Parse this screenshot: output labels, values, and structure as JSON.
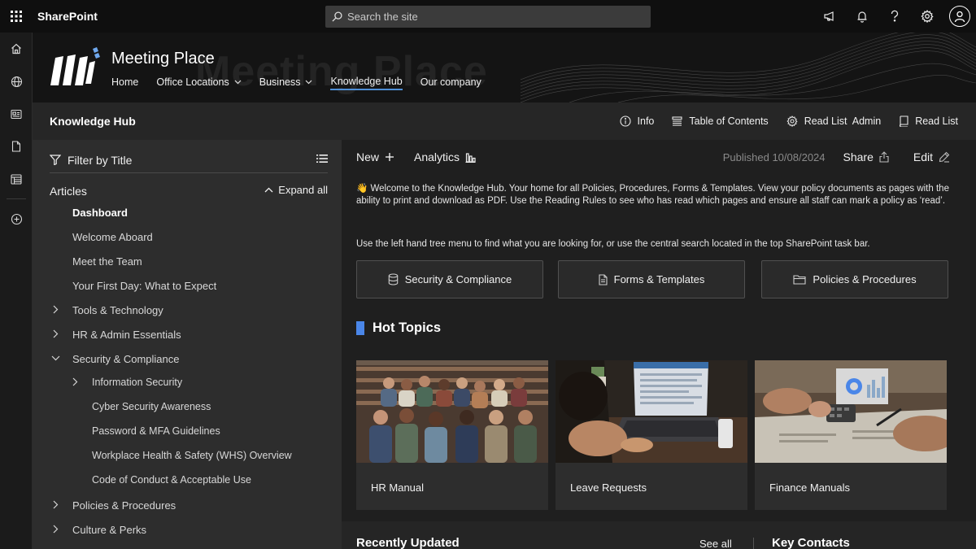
{
  "suite": {
    "brand": "SharePoint",
    "search_placeholder": "Search the site",
    "icons": [
      "waffle-icon",
      "megaphone-icon",
      "bell-icon",
      "help-icon",
      "gear-icon",
      "user-avatar-icon"
    ]
  },
  "appbar": {
    "icons": [
      "home-icon",
      "globe-icon",
      "news-icon",
      "file-icon",
      "lists-icon",
      "add-icon"
    ]
  },
  "site": {
    "title": "Meeting Place",
    "watermark": "Meeting Place",
    "nav": [
      {
        "label": "Home"
      },
      {
        "label": "Office Locations"
      },
      {
        "label": "Business"
      },
      {
        "label": "Knowledge Hub"
      },
      {
        "label": "Our company"
      }
    ]
  },
  "page": {
    "title": "Knowledge Hub",
    "actions": [
      {
        "label": "Info",
        "icon": "info-icon"
      },
      {
        "label": "Table of Contents",
        "icon": "toc-icon"
      },
      {
        "label": "Read List  Admin",
        "icon": "settings-icon"
      },
      {
        "label": "Read List",
        "icon": "book-icon"
      }
    ]
  },
  "nav": {
    "filter_label": "Filter by Title",
    "section_label": "Articles",
    "expand_all": "Expand all",
    "items": [
      {
        "label": "Dashboard"
      },
      {
        "label": "Welcome Aboard"
      },
      {
        "label": "Meet the Team"
      },
      {
        "label": "Your First Day: What to Expect"
      },
      {
        "label": "Tools & Technology"
      },
      {
        "label": "HR & Admin Essentials"
      },
      {
        "label": "Security & Compliance"
      },
      {
        "label": "Information Security"
      },
      {
        "label": "Cyber Security Awareness"
      },
      {
        "label": "Password & MFA Guidelines"
      },
      {
        "label": "Workplace Health & Safety (WHS) Overview"
      },
      {
        "label": "Code of Conduct & Acceptable Use"
      },
      {
        "label": "Policies & Procedures"
      },
      {
        "label": "Culture & Perks"
      }
    ]
  },
  "main": {
    "new_label": "New",
    "analytics_label": "Analytics",
    "published": "Published 10/08/2024",
    "share_label": "Share",
    "edit_label": "Edit",
    "intro": "👋 Welcome to the Knowledge Hub. Your home for all Policies, Procedures, Forms & Templates. View your policy documents as pages with the ability to print and download as PDF. Use the Reading Rules to see who has read which pages and ensure all staff can mark a policy as ‘read’.",
    "intro2": "Use the left hand tree menu to find what you are looking for, or use the central search located in the top SharePoint task bar.",
    "categories": [
      {
        "label": "Security & Compliance",
        "icon": "database-icon"
      },
      {
        "label": "Forms & Templates",
        "icon": "document-icon"
      },
      {
        "label": "Policies & Procedures",
        "icon": "folder-icon"
      }
    ],
    "hot_topics_title": "Hot Topics",
    "cards": [
      {
        "label": "HR Manual"
      },
      {
        "label": "Leave Requests"
      },
      {
        "label": "Finance Manuals"
      }
    ],
    "recently_updated": "Recently Updated",
    "see_all": "See all",
    "key_contacts": "Key Contacts"
  },
  "colors": {
    "accent": "#4a86e8",
    "suitebar": "#0f0f0f",
    "nav_panel": "#2d2d2d",
    "content_bg": "#1f1f1f"
  }
}
